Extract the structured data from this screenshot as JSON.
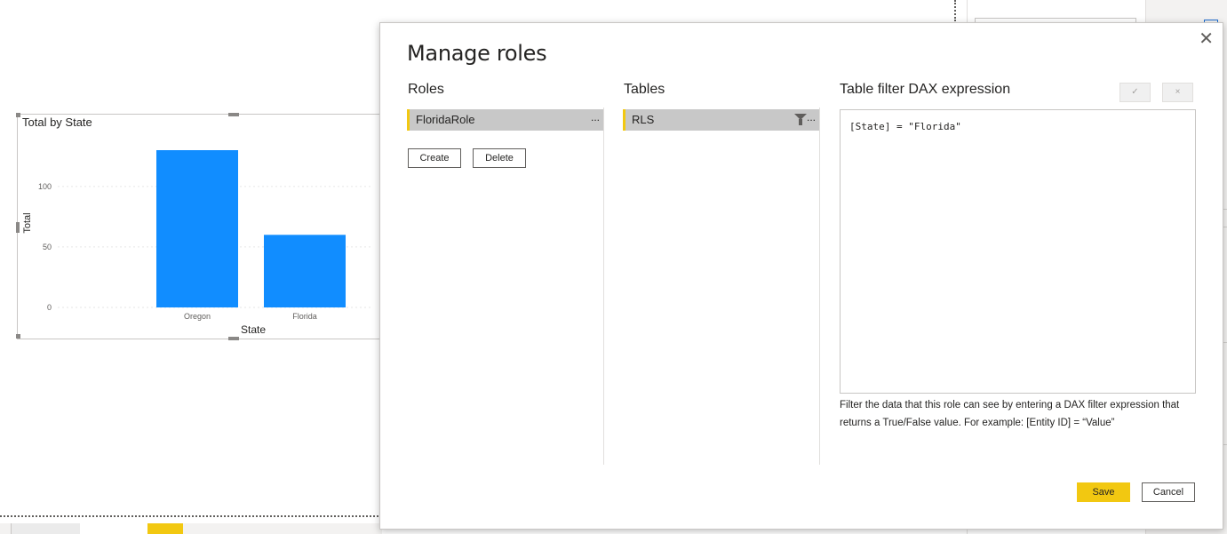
{
  "chart_data": {
    "type": "bar",
    "title": "Total by State",
    "categories": [
      "Oregon",
      "Florida"
    ],
    "values": [
      130,
      60
    ],
    "xlabel": "State",
    "ylabel": "Total",
    "yticks": [
      0,
      50,
      100
    ],
    "ylim": [
      0,
      130
    ],
    "bar_color": "#118DFF",
    "grid": true
  },
  "dialog": {
    "title": "Manage roles",
    "close_icon": "close-icon",
    "roles": {
      "header": "Roles",
      "items": [
        {
          "label": "FloridaRole",
          "more": "..."
        }
      ],
      "create_label": "Create",
      "delete_label": "Delete"
    },
    "tables": {
      "header": "Tables",
      "items": [
        {
          "label": "RLS",
          "more": "...",
          "icon": "filter-icon"
        }
      ]
    },
    "dax": {
      "header": "Table filter DAX expression",
      "expression": "[State] = \"Florida\"",
      "check_label": "✓",
      "cancel_label": "×",
      "help_text": "Filter the data that this role can see by entering a DAX filter expression that returns a True/False value. For example: [Entity ID] = “Value”"
    },
    "save_label": "Save",
    "cancel_label": "Cancel"
  },
  "colors": {
    "accent": "#F2C811",
    "selected_row": "#C8C8C8"
  }
}
